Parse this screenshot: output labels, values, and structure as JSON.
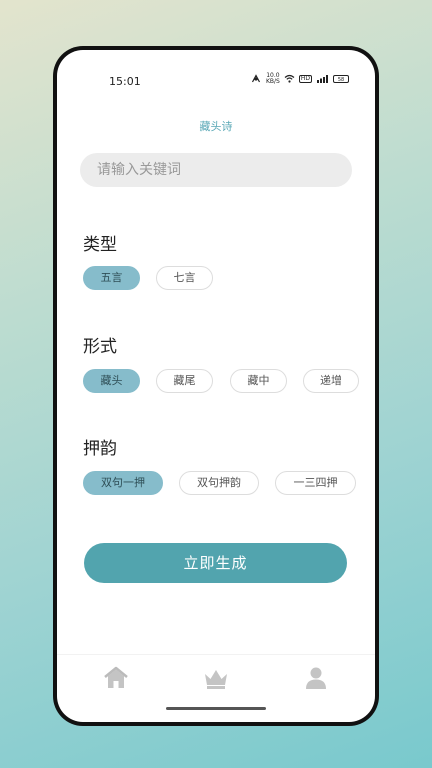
{
  "status_bar": {
    "time": "15:01",
    "network_speed": "10.0",
    "network_unit": "KB/S",
    "battery": "58",
    "hd_label": "HD",
    "signal_label": "5G"
  },
  "header": {
    "title": "藏头诗"
  },
  "search": {
    "placeholder": "请输入关键词",
    "value": ""
  },
  "sections": {
    "type": {
      "title": "类型",
      "options": [
        "五言",
        "七言"
      ],
      "selected": "五言"
    },
    "form": {
      "title": "形式",
      "options": [
        "藏头",
        "藏尾",
        "藏中",
        "递增"
      ],
      "selected": "藏头"
    },
    "rhyme": {
      "title": "押韵",
      "options": [
        "双句一押",
        "双句押韵",
        "一三四押"
      ],
      "selected": "双句一押"
    }
  },
  "generate_button": {
    "label": "立即生成"
  },
  "bottom_nav": {
    "items": [
      {
        "icon": "home-icon"
      },
      {
        "icon": "crown-icon"
      },
      {
        "icon": "user-icon"
      }
    ]
  },
  "colors": {
    "accent": "#52a4ae",
    "chip_active": "#86bccb",
    "title": "#5aa8b6"
  }
}
